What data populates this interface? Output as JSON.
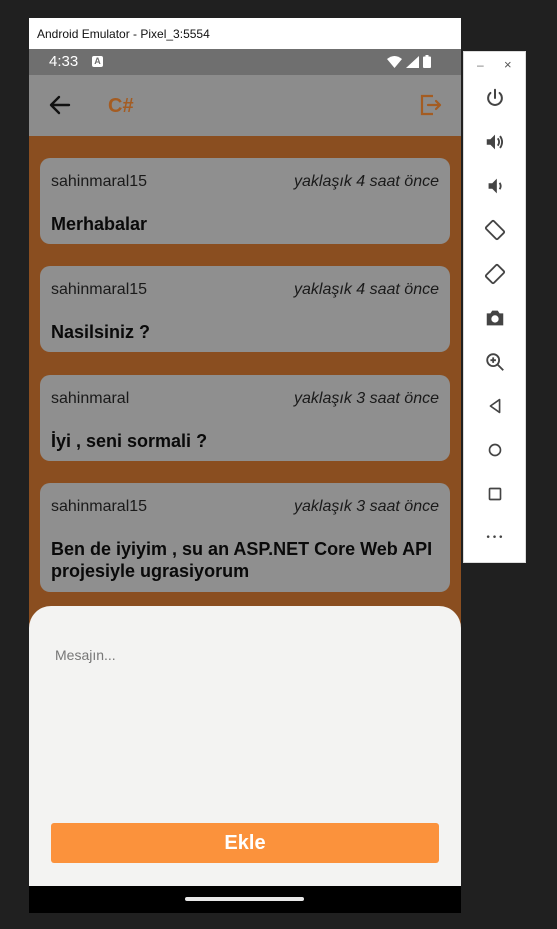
{
  "emulator": {
    "title": "Android Emulator - Pixel_3:5554"
  },
  "status_bar": {
    "time": "4:33",
    "notification_icon": "A"
  },
  "app_bar": {
    "title": "C#",
    "back_icon": "arrow-left-icon",
    "logout_icon": "logout-icon"
  },
  "messages": [
    {
      "user": "sahinmaral15",
      "time": "yaklaşık 4 saat önce",
      "text": "Merhabalar"
    },
    {
      "user": "sahinmaral15",
      "time": "yaklaşık 4 saat önce",
      "text": "Nasilsiniz ?"
    },
    {
      "user": "sahinmaral",
      "time": "yaklaşık 3 saat önce",
      "text": "İyi , seni sormali ?"
    },
    {
      "user": "sahinmaral15",
      "time": "yaklaşık 3 saat önce",
      "text": "Ben de iyiyim , su an ASP.NET Core Web API projesiyle ugrasiyorum"
    }
  ],
  "composer": {
    "placeholder": "Mesajın...",
    "value": "",
    "submit_label": "Ekle"
  },
  "side_toolbar": {
    "minimize": "–",
    "close": "×",
    "more": "•••"
  },
  "colors": {
    "accent": "#fb923c",
    "title": "#a45c22",
    "backdrop": "#8a4e20"
  }
}
